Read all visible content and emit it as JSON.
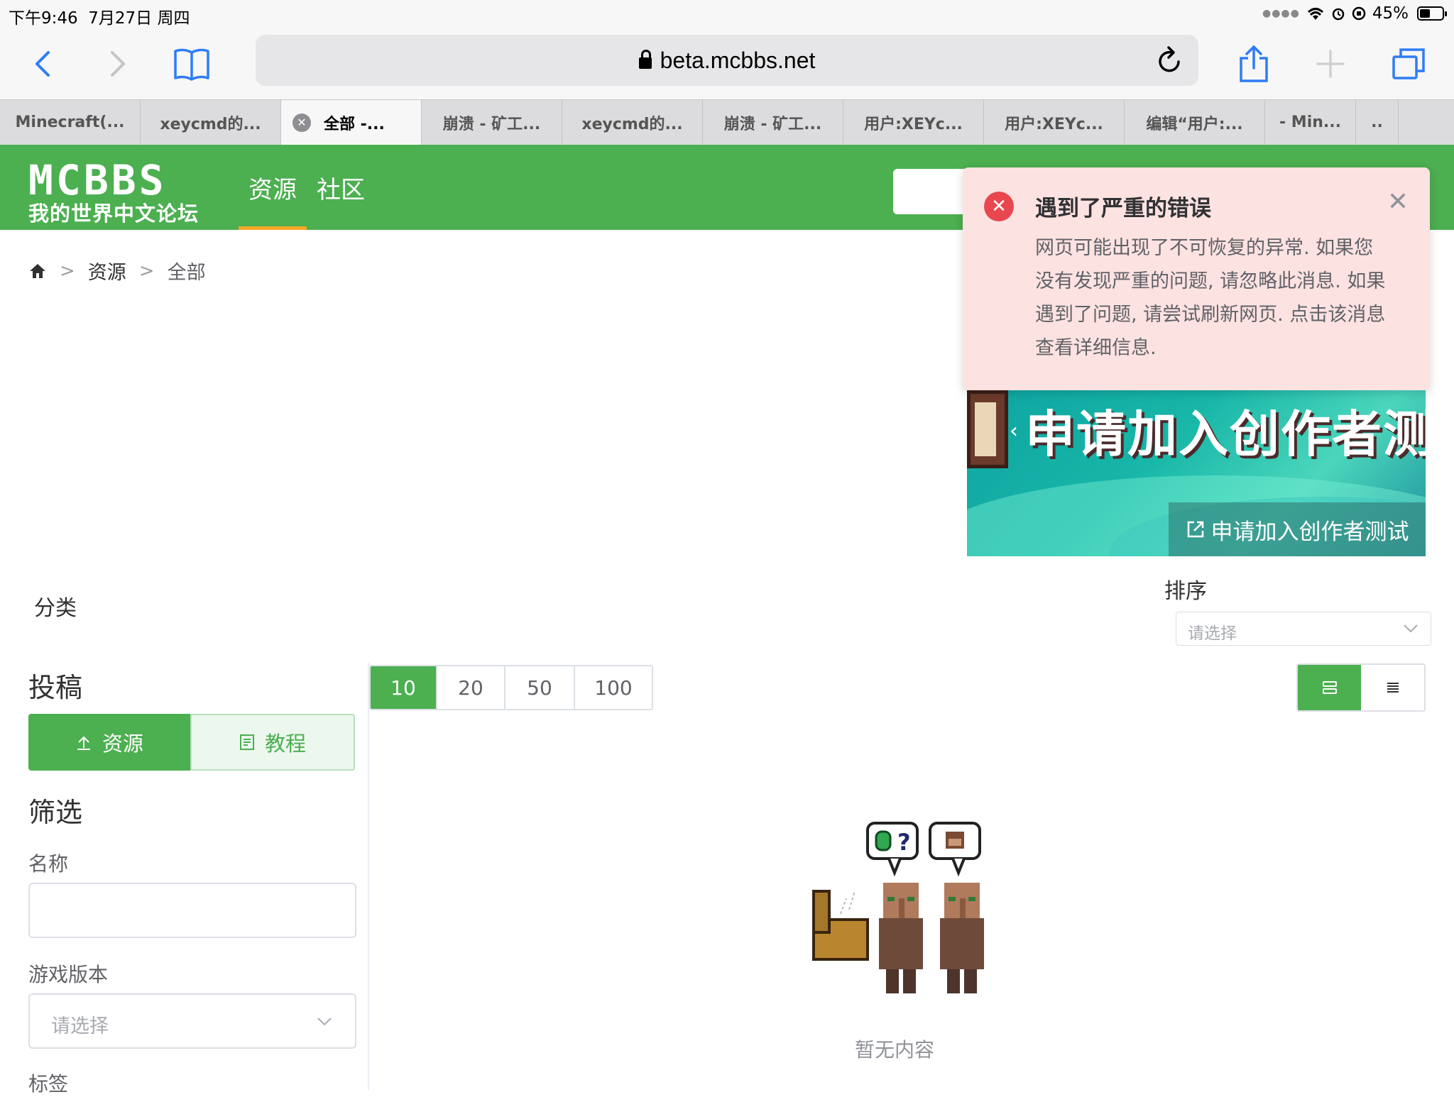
{
  "status": {
    "time": "下午9:46",
    "date": "7月27日 周四",
    "battery_pct": "45%",
    "battery_level": 0.45
  },
  "browser": {
    "url": "beta.mcbbs.net",
    "tabs": [
      {
        "label": "Minecraft(..."
      },
      {
        "label": "xeycmd的..."
      },
      {
        "label": "全部 -...",
        "active": true
      },
      {
        "label": "崩溃 - 矿工..."
      },
      {
        "label": "xeycmd的..."
      },
      {
        "label": "崩溃 - 矿工..."
      },
      {
        "label": "用户:XEYc..."
      },
      {
        "label": "用户:XEYc..."
      },
      {
        "label": "编辑“用户:..."
      },
      {
        "label": "- Min..."
      },
      {
        "label": ".."
      }
    ]
  },
  "site": {
    "logo_top": "MCBBS",
    "logo_bottom": "我的世界中文论坛",
    "nav": [
      {
        "label": "资源",
        "active": true
      },
      {
        "label": "社区",
        "active": false
      }
    ],
    "brand_color": "#4caf50"
  },
  "breadcrumb": {
    "items": [
      "资源",
      "全部"
    ]
  },
  "toast": {
    "title": "遇到了严重的错误",
    "message": "网页可能出现了不可恢复的异常. 如果您没有发现严重的问题, 请忽略此消息. 如果遇到了问题, 请尝试刷新网页. 点击该消息查看详细信息."
  },
  "banner": {
    "headline": "申请加入创作者测试",
    "caption": "申请加入创作者测试"
  },
  "sort": {
    "label": "排序",
    "placeholder": "请选择"
  },
  "sidebar": {
    "category_label": "分类",
    "submit_heading": "投稿",
    "submit_resource": "资源",
    "submit_tutorial": "教程",
    "filter_heading": "筛选",
    "name_label": "名称",
    "name_value": "",
    "version_label": "游戏版本",
    "version_placeholder": "请选择",
    "tag_label": "标签"
  },
  "page_sizes": [
    {
      "label": "10",
      "active": true
    },
    {
      "label": "20",
      "active": false
    },
    {
      "label": "50",
      "active": false
    },
    {
      "label": "100",
      "active": false
    }
  ],
  "empty": {
    "text": "暂无内容"
  }
}
